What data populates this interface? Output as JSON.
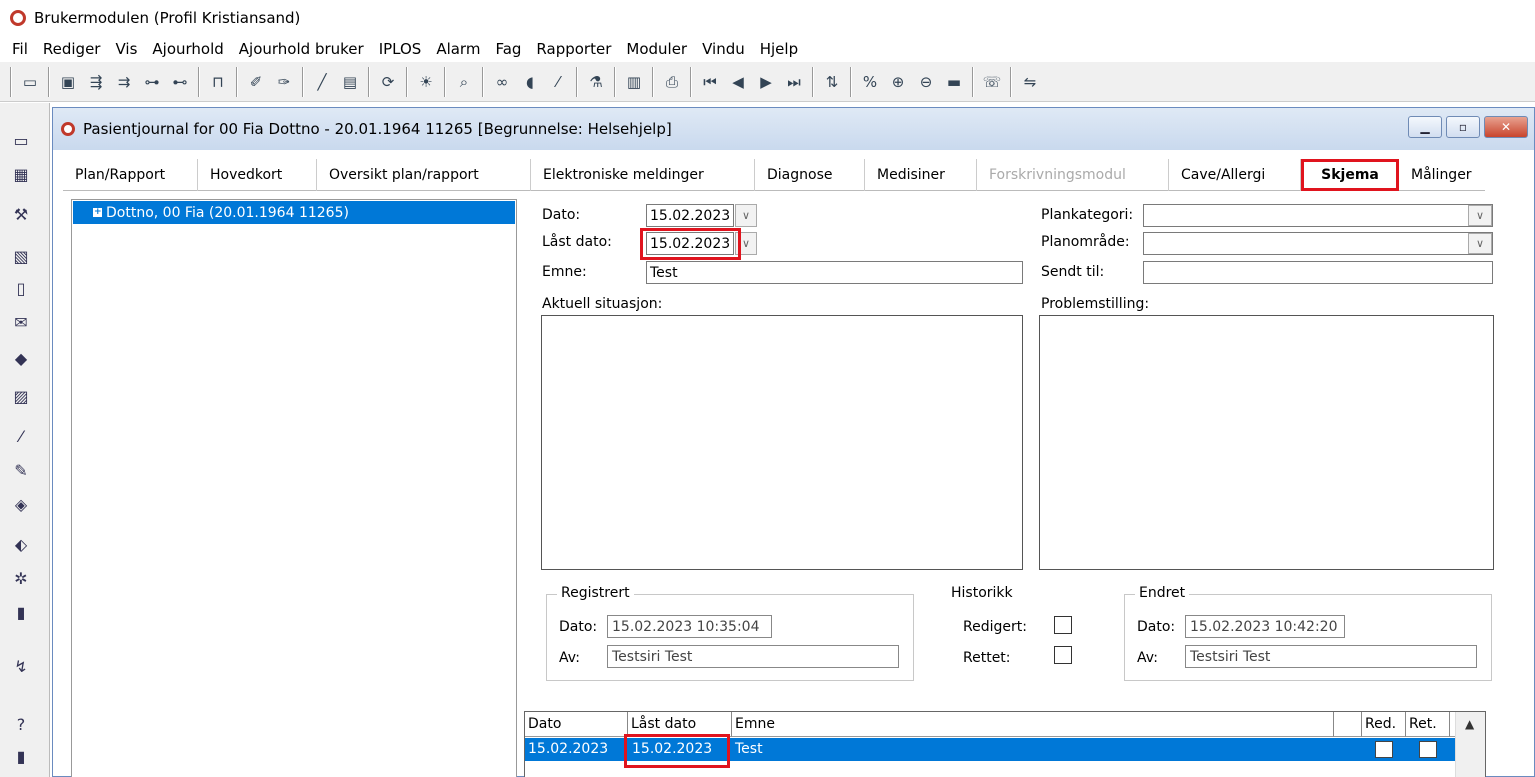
{
  "app": {
    "title": "Brukermodulen (Profil Kristiansand)"
  },
  "menu": [
    "Fil",
    "Rediger",
    "Vis",
    "Ajourhold",
    "Ajourhold bruker",
    "IPLOS",
    "Alarm",
    "Fag",
    "Rapporter",
    "Moduler",
    "Vindu",
    "Hjelp"
  ],
  "window": {
    "title": "Pasientjournal for 00 Fia Dottno - 20.01.1964 11265  [Begrunnelse: Helsehjelp]"
  },
  "tabs": [
    "Plan/Rapport",
    "Hovedkort",
    "Oversikt plan/rapport",
    "Elektroniske meldinger",
    "Diagnose",
    "Medisiner",
    "Forskrivningsmodul",
    "Cave/Allergi",
    "Skjema",
    "Målinger"
  ],
  "tree": {
    "item": "Dottno, 00 Fia (20.01.1964 11265)"
  },
  "form": {
    "dato_label": "Dato:",
    "dato_value": "15.02.2023",
    "last_dato_label": "Låst dato:",
    "last_dato_value": "15.02.2023",
    "emne_label": "Emne:",
    "emne_value": "Test",
    "plankategori_label": "Plankategori:",
    "plankategori_value": "",
    "planomrade_label": "Planområde:",
    "planomrade_value": "",
    "sendt_til_label": "Sendt til:",
    "sendt_til_value": "",
    "aktuell_label": "Aktuell situasjon:",
    "problem_label": "Problemstilling:"
  },
  "registrert": {
    "title": "Registrert",
    "dato_label": "Dato:",
    "dato_value": "15.02.2023  10:35:04",
    "av_label": "Av:",
    "av_value": "Testsiri Test"
  },
  "historikk": {
    "title": "Historikk",
    "redigert_label": "Redigert:",
    "rettet_label": "Rettet:"
  },
  "endret": {
    "title": "Endret",
    "dato_label": "Dato:",
    "dato_value": "15.02.2023  10:42:20",
    "av_label": "Av:",
    "av_value": "Testsiri Test"
  },
  "grid": {
    "headers": [
      "Dato",
      "Låst dato",
      "Emne",
      "",
      "Red.",
      "Ret."
    ],
    "rows": [
      {
        "dato": "15.02.2023",
        "last_dato": "15.02.2023",
        "emne": "Test"
      }
    ]
  },
  "colors": {
    "accent": "#0078d7",
    "highlight": "#e0141e"
  }
}
